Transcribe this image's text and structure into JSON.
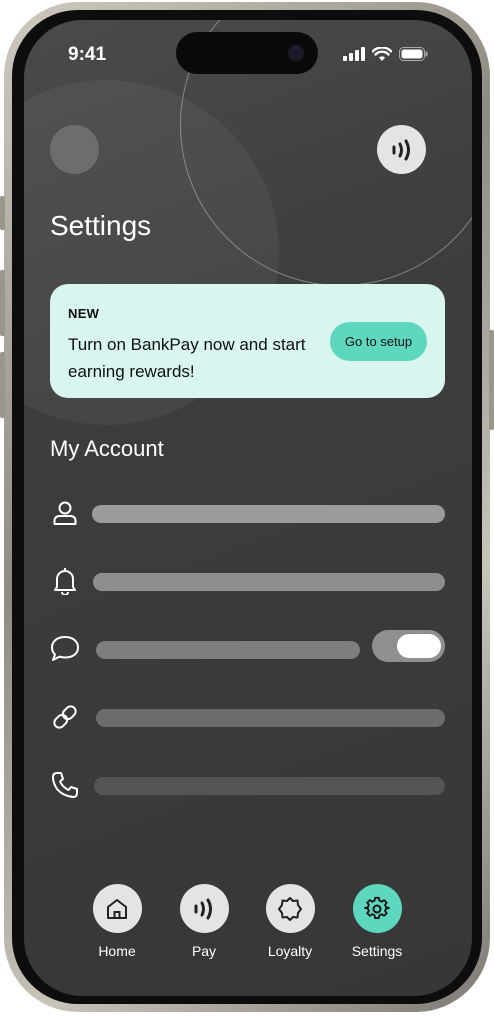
{
  "status_bar": {
    "time": "9:41"
  },
  "header": {
    "title": "Settings"
  },
  "banner": {
    "tag": "NEW",
    "message": "Turn on BankPay now and start earning rewards!",
    "button_label": "Go to setup"
  },
  "account": {
    "title": "My Account",
    "items": [
      {
        "icon": "person-icon"
      },
      {
        "icon": "bell-icon"
      },
      {
        "icon": "chat-icon",
        "toggle_on": true
      },
      {
        "icon": "link-icon"
      },
      {
        "icon": "phone-icon"
      }
    ]
  },
  "nav": {
    "items": [
      {
        "label": "Home",
        "icon": "home-icon"
      },
      {
        "label": "Pay",
        "icon": "nfc-icon"
      },
      {
        "label": "Loyalty",
        "icon": "badge-icon"
      },
      {
        "label": "Settings",
        "icon": "gear-icon",
        "active": true
      }
    ]
  },
  "colors": {
    "accent": "#5dd8be",
    "banner_bg": "#d8f6ef",
    "screen_bg": "#3d3d3d"
  }
}
